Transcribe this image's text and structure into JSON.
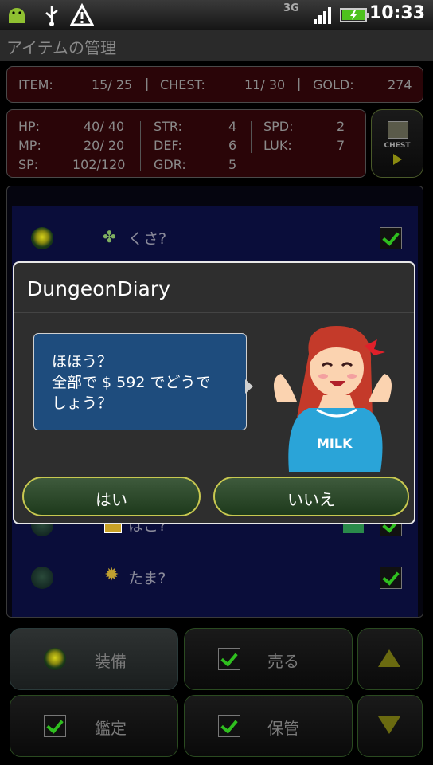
{
  "status_bar": {
    "time": "10:33",
    "network": "3G"
  },
  "title_bar": {
    "title": "アイテムの管理"
  },
  "summary": {
    "item_label": "ITEM:",
    "item_value": "15/ 25",
    "chest_label": "CHEST:",
    "chest_value": "11/ 30",
    "gold_label": "GOLD:",
    "gold_value": "274"
  },
  "stats": {
    "hp_label": "HP:",
    "hp_value": "40/ 40",
    "mp_label": "MP:",
    "mp_value": "20/ 20",
    "sp_label": "SP:",
    "sp_value": "102/120",
    "str_label": "STR:",
    "str_value": "4",
    "def_label": "DEF:",
    "def_value": "6",
    "gdr_label": "GDR:",
    "gdr_value": "5",
    "spd_label": "SPD:",
    "spd_value": "2",
    "luk_label": "LUK:",
    "luk_value": "7"
  },
  "chest_button": {
    "label": "CHEST"
  },
  "items": [
    {
      "name": "くさ?"
    },
    {
      "name": "はこ?"
    },
    {
      "name": "たま?"
    }
  ],
  "buttons": {
    "equip": "装備",
    "sell": "売る",
    "appraise": "鑑定",
    "store": "保管"
  },
  "dialog": {
    "title": "DungeonDiary",
    "message_line1": "ほほう？",
    "message_line2": "全部で $ 592 でどうで",
    "message_line3": "しょう？",
    "yes": "はい",
    "no": "いいえ",
    "shirt_text": "MILK"
  },
  "colors": {
    "accent_yellow": "#c8c850",
    "bubble_blue": "#1e4c7d",
    "check_green": "#2fbf1f"
  }
}
